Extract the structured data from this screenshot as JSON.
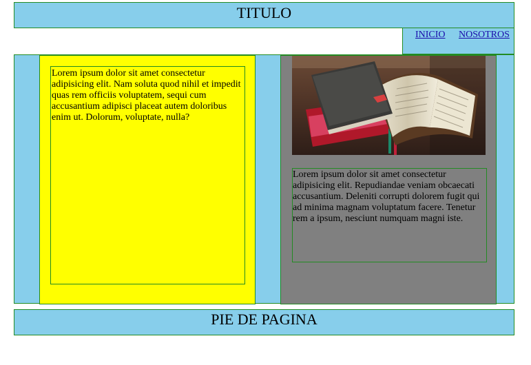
{
  "header": {
    "title": "TITULO"
  },
  "nav": {
    "links": [
      {
        "label": "INICIO"
      },
      {
        "label": "NOSOTROS"
      }
    ]
  },
  "main": {
    "left_text": "Lorem ipsum dolor sit amet consectetur adipisicing elit. Nam soluta quod nihil et impedit quas rem officiis voluptatem, sequi cum accusantium adipisci placeat autem doloribus enim ut. Dolorum, voluptate, nulla?",
    "right_text": "Lorem ipsum dolor sit amet consectetur adipisicing elit. Repudiandae veniam obcaecati accusantium. Deleniti corrupti dolorem fugit qui ad minima magnam voluptatum facere. Tenetur rem a ipsum, nesciunt numquam magni iste.",
    "image": {
      "icon": "books-photo"
    }
  },
  "footer": {
    "text": "PIE DE PAGINA"
  },
  "colors": {
    "section_bg": "#87ceeb",
    "left_column_bg": "#ffff00",
    "right_column_bg": "#808080",
    "border": "#228b22"
  }
}
